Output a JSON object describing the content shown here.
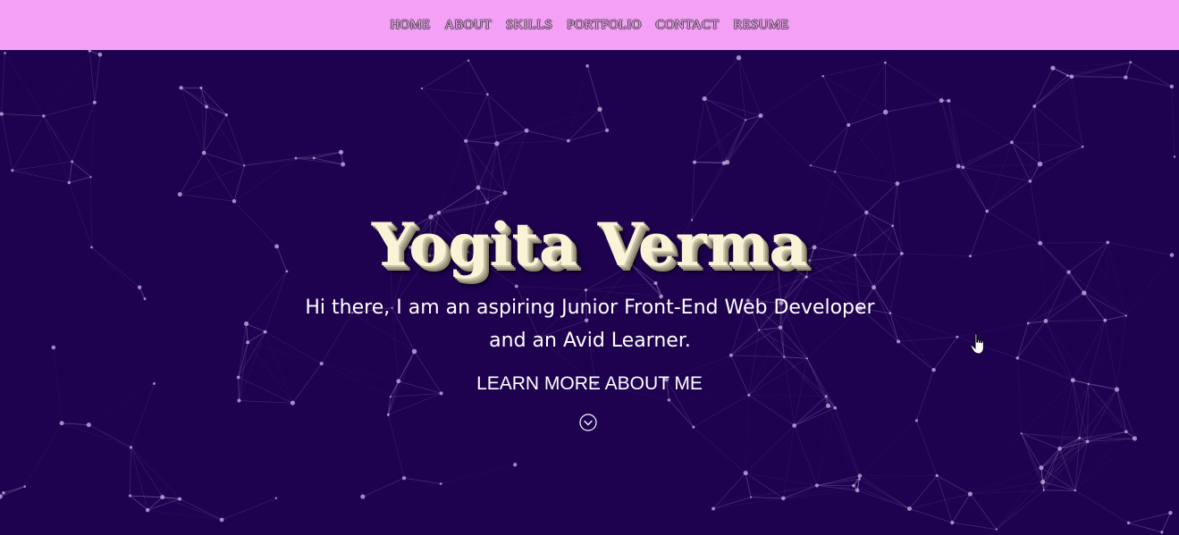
{
  "nav": {
    "items": [
      "HOME",
      "ABOUT",
      "SKILLS",
      "PORTFOLIO",
      "CONTACT",
      "RESUME"
    ],
    "background_color": "#f5a0f7"
  },
  "hero": {
    "title": "Yogita Verma",
    "subtitle_line1": "Hi there, I am an aspiring Junior Front-End Web Developer",
    "subtitle_line2": "and an Avid Learner.",
    "cta": "LEARN MORE ABOUT ME",
    "scroll_icon": "chevron-down-circle-icon",
    "background_color": "#1e0250",
    "title_color": "#fbf3d5"
  },
  "cursor": {
    "icon": "hand-pointer-icon"
  }
}
